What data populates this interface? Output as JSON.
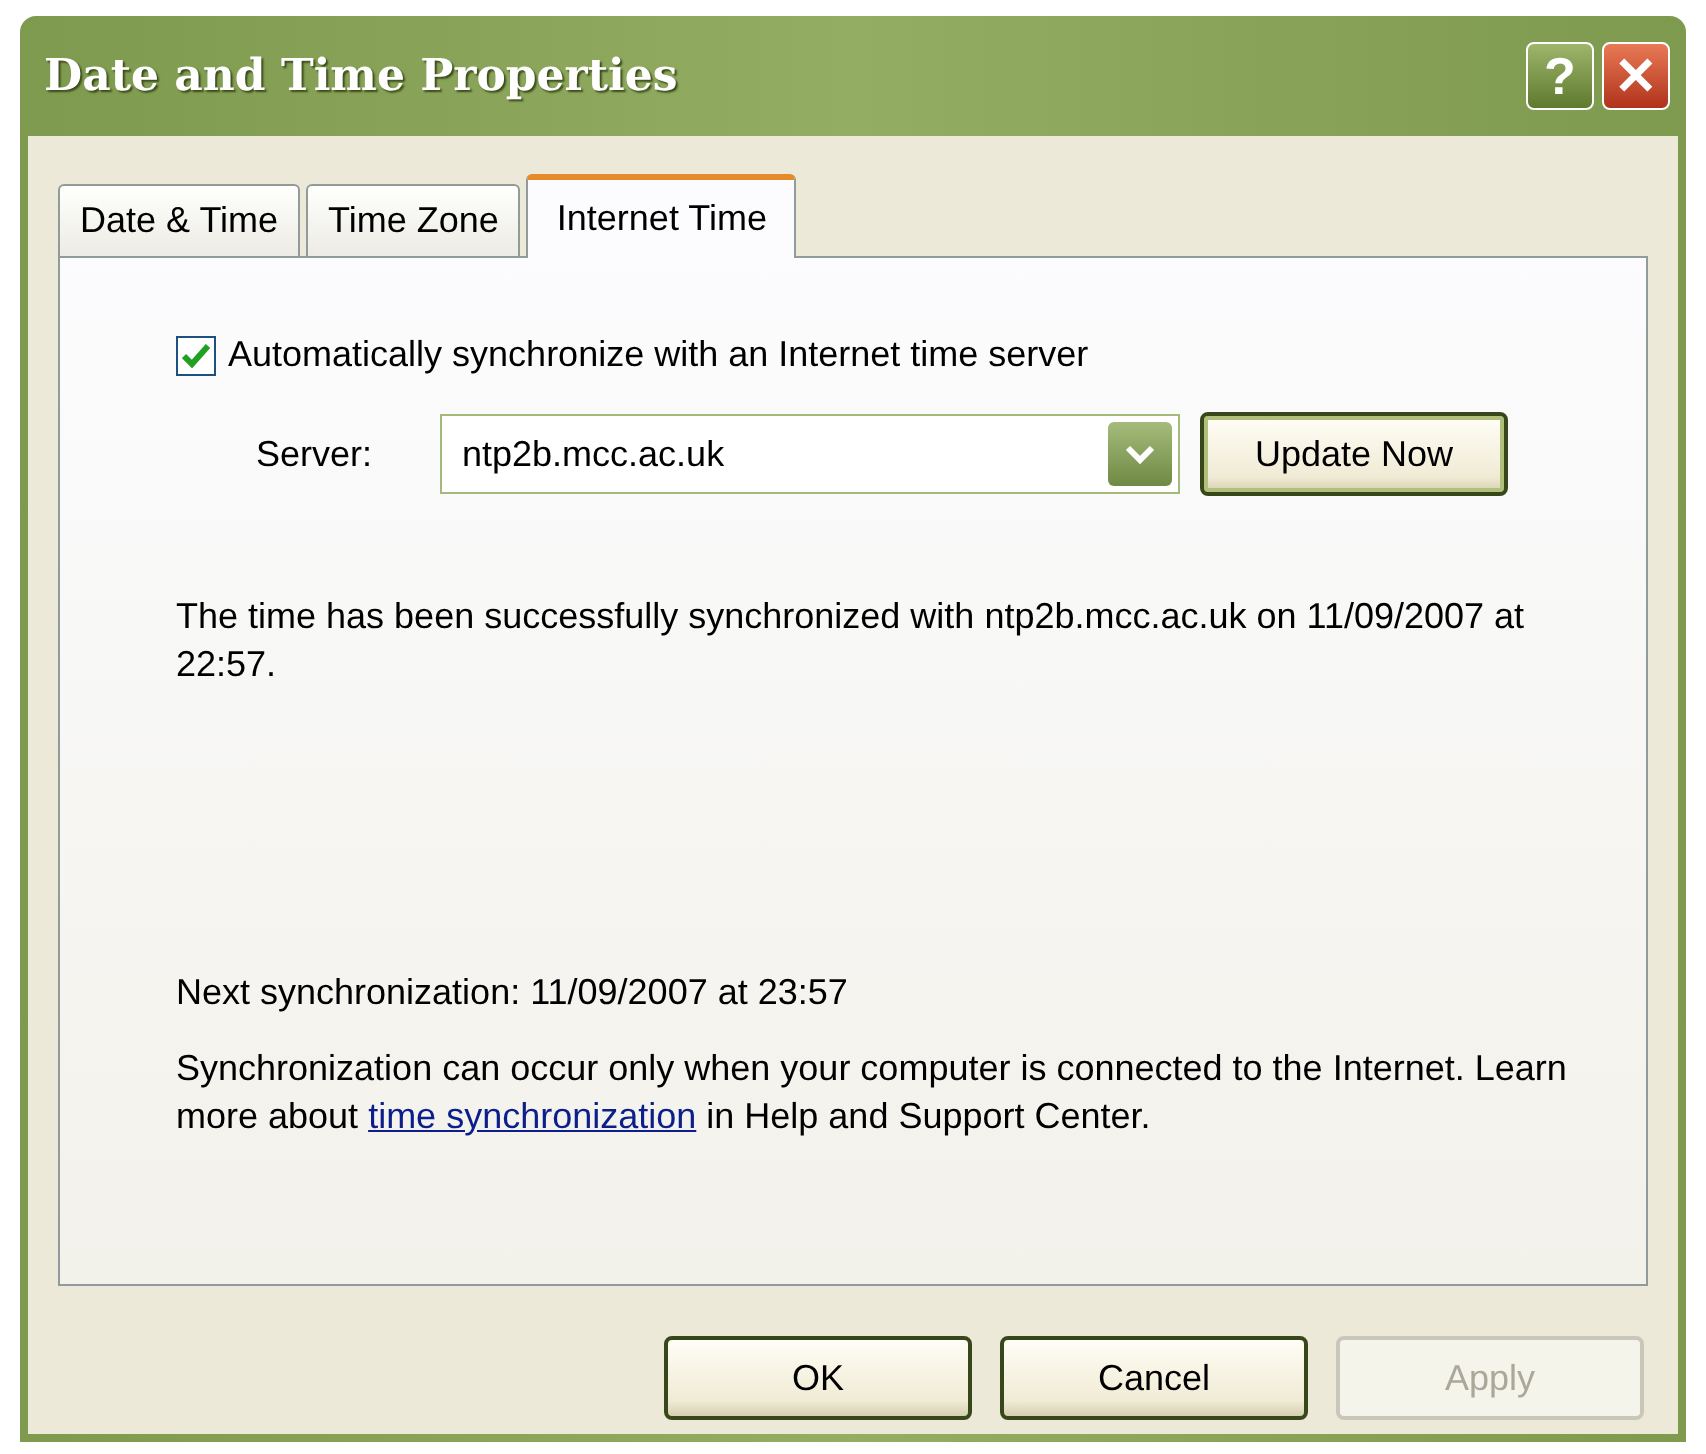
{
  "window": {
    "title": "Date and Time Properties",
    "buttons": [
      {
        "kind": "help",
        "label": "?"
      },
      {
        "kind": "close",
        "label": "✕"
      }
    ]
  },
  "tabs": [
    {
      "label": "Date & Time",
      "selected": false
    },
    {
      "label": "Time Zone",
      "selected": false
    },
    {
      "label": "Internet Time",
      "selected": true
    }
  ],
  "auto_sync": {
    "label": "Automatically synchronize with an Internet time server",
    "checked": true
  },
  "server": {
    "label": "Server:",
    "value": "ntp2b.mcc.ac.uk",
    "update_button": "Update Now"
  },
  "status_message": "The time has been successfully synchronized with ntp2b.mcc.ac.uk on 11/09/2007 at 22:57.",
  "next_sync": "Next synchronization: 11/09/2007 at 23:57",
  "info": {
    "before": "Synchronization can occur only when your computer is connected to the Internet.  Learn more about ",
    "link": "time synchronization",
    "after": " in Help and Support Center."
  },
  "buttons": [
    {
      "label": "OK",
      "disabled": false
    },
    {
      "label": "Cancel",
      "disabled": false
    },
    {
      "label": "Apply",
      "disabled": true
    }
  ]
}
